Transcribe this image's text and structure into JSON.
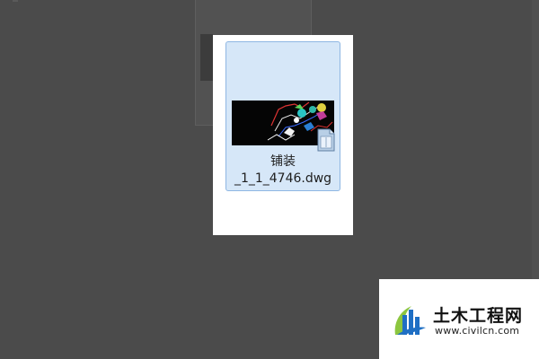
{
  "file": {
    "name_line1": "铺装",
    "name_line2": "_1_1_4746.dwg",
    "thumbnail_icon": "dwg-thumbnail",
    "badge_icon": "autocad-file-icon",
    "selected": true
  },
  "watermark": {
    "title": "土木工程网",
    "url": "www.civilcn.com",
    "logo_icon": "civilcn-logo",
    "colors": {
      "blue": "#1f6fc4",
      "green": "#8cc63f"
    }
  },
  "colors": {
    "desktop_bg": "#4b4b4b",
    "selection_fill": "#d6e7f8",
    "selection_border": "#8fb7e3"
  }
}
